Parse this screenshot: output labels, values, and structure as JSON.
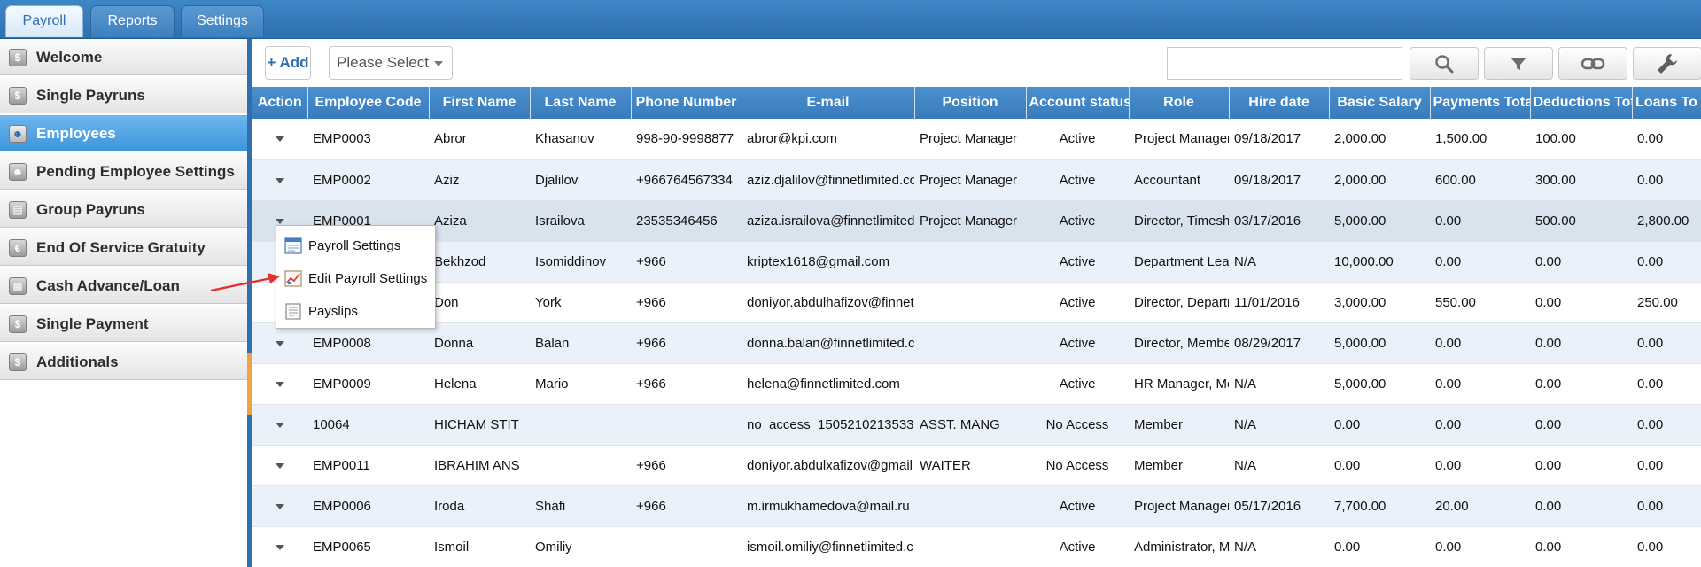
{
  "tabs": [
    {
      "label": "Payroll",
      "active": true
    },
    {
      "label": "Reports",
      "active": false
    },
    {
      "label": "Settings",
      "active": false
    }
  ],
  "sidebar": {
    "items": [
      {
        "label": "Welcome",
        "icon": "dollar-icon",
        "active": false
      },
      {
        "label": "Single Payruns",
        "icon": "dollar-icon",
        "active": false
      },
      {
        "label": "Employees",
        "icon": "employee-icon",
        "active": true
      },
      {
        "label": "Pending Employee Settings",
        "icon": "employee-settings-icon",
        "active": false
      },
      {
        "label": "Group Payruns",
        "icon": "group-payrun-icon",
        "active": false
      },
      {
        "label": "End Of Service Gratuity",
        "icon": "euro-icon",
        "active": false
      },
      {
        "label": "Cash Advance/Loan",
        "icon": "cash-icon",
        "active": false
      },
      {
        "label": "Single Payment",
        "icon": "single-payment-icon",
        "active": false
      },
      {
        "label": "Additionals",
        "icon": "additionals-icon",
        "active": false
      }
    ]
  },
  "toolbar": {
    "add_label": "+ Add",
    "select_value": "Please Select",
    "search_value": "",
    "search_icon": "search-icon",
    "filter_icon": "filter-icon",
    "link_icon": "link-icon",
    "settings_icon": "wrench-icon"
  },
  "grid": {
    "columns": [
      "Action",
      "Employee Code",
      "First Name",
      "Last Name",
      "Phone Number",
      "E-mail",
      "Position",
      "Account status",
      "Role",
      "Hire date",
      "Basic Salary",
      "Payments Tota",
      "Deductions Tot",
      "Loans To"
    ],
    "rows": [
      [
        "",
        "EMP0003",
        "Abror",
        "Khasanov",
        "998-90-9998877",
        "abror@kpi.com",
        "Project Manager",
        "Active",
        "Project Manager",
        "09/18/2017",
        "2,000.00",
        "1,500.00",
        "100.00",
        "0.00"
      ],
      [
        "",
        "EMP0002",
        "Aziz",
        "Djalilov",
        "+966764567334",
        "aziz.djalilov@finnetlimited.co",
        "Project Manager",
        "Active",
        "Accountant",
        "09/18/2017",
        "2,000.00",
        "600.00",
        "300.00",
        "0.00"
      ],
      [
        "",
        "EMP0001",
        "Aziza",
        "Israilova",
        "23535346456",
        "aziza.israilova@finnetlimited",
        "Project Manager",
        "Active",
        "Director, Timesh",
        "03/17/2016",
        "5,000.00",
        "0.00",
        "500.00",
        "2,800.00"
      ],
      [
        "",
        "",
        "Bekhzod",
        "Isomiddinov",
        "+966",
        "kriptex1618@gmail.com",
        "",
        "Active",
        "Department Lea",
        "N/A",
        "10,000.00",
        "0.00",
        "0.00",
        "0.00"
      ],
      [
        "",
        "",
        "Don",
        "York",
        "+966",
        "doniyor.abdulhafizov@finnet",
        "",
        "Active",
        "Director, Departr",
        "11/01/2016",
        "3,000.00",
        "550.00",
        "0.00",
        "250.00"
      ],
      [
        "",
        "EMP0008",
        "Donna",
        "Balan",
        "+966",
        "donna.balan@finnetlimited.c",
        "",
        "Active",
        "Director, Membe",
        "08/29/2017",
        "5,000.00",
        "0.00",
        "0.00",
        "0.00"
      ],
      [
        "",
        "EMP0009",
        "Helena",
        "Mario",
        "+966",
        "helena@finnetlimited.com",
        "",
        "Active",
        "HR Manager, Me",
        "N/A",
        "5,000.00",
        "0.00",
        "0.00",
        "0.00"
      ],
      [
        "",
        "10064",
        "HICHAM STIT",
        "",
        "",
        "no_access_1505210213533",
        "ASST. MANG",
        "No Access",
        "Member",
        "N/A",
        "0.00",
        "0.00",
        "0.00",
        "0.00"
      ],
      [
        "",
        "EMP0011",
        "IBRAHIM ANS",
        "",
        "+966",
        "doniyor.abdulxafizov@gmail",
        "WAITER",
        "No Access",
        "Member",
        "N/A",
        "0.00",
        "0.00",
        "0.00",
        "0.00"
      ],
      [
        "",
        "EMP0006",
        "Iroda",
        "Shafi",
        "+966",
        "m.irmukhamedova@mail.ru",
        "",
        "Active",
        "Project Manager",
        "05/17/2016",
        "7,700.00",
        "20.00",
        "0.00",
        "0.00"
      ],
      [
        "",
        "EMP0065",
        "Ismoil",
        "Omiliy",
        "",
        "ismoil.omiliy@finnetlimited.c",
        "",
        "Active",
        "Administrator, M",
        "N/A",
        "0.00",
        "0.00",
        "0.00",
        "0.00"
      ]
    ]
  },
  "context_menu": {
    "items": [
      {
        "label": "Payroll Settings",
        "icon": "payroll-settings-icon"
      },
      {
        "label": "Edit Payroll Settings",
        "icon": "edit-settings-icon"
      },
      {
        "label": "Payslips",
        "icon": "payslip-icon"
      }
    ]
  },
  "colors": {
    "header_blue": "#3a7bbb",
    "active_sidebar": "#3d95da",
    "arrow_red": "#e53030",
    "splitter_orange": "#f0a341"
  }
}
